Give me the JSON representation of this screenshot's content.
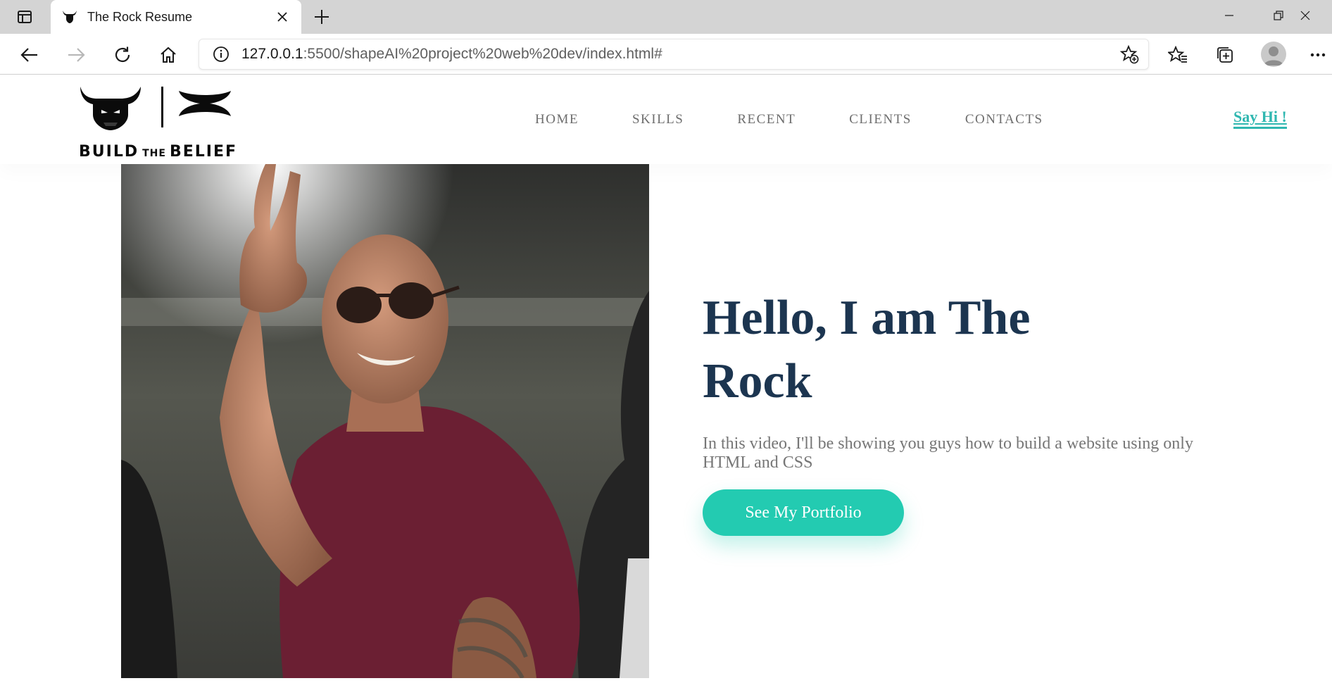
{
  "browser": {
    "tab_title": "The Rock Resume",
    "url_host": "127.0.0.1",
    "url_rest": ":5500/shapeAI%20project%20web%20dev/index.html#"
  },
  "site": {
    "logo_text_left": "BUILD",
    "logo_text_mid": "THE",
    "logo_text_right": "BELIEF",
    "nav": [
      "HOME",
      "SKILLS",
      "RECENT",
      "CLIENTS",
      "CONTACTS"
    ],
    "say_hi": "Say Hi !",
    "accent_color": "#23cbb1",
    "heading_color": "#1c3550"
  },
  "hero": {
    "title": "Hello, I am The Rock",
    "description": "In this video, I'll be showing you guys how to build a website using only HTML and CSS",
    "cta_label": "See My Portfolio"
  }
}
